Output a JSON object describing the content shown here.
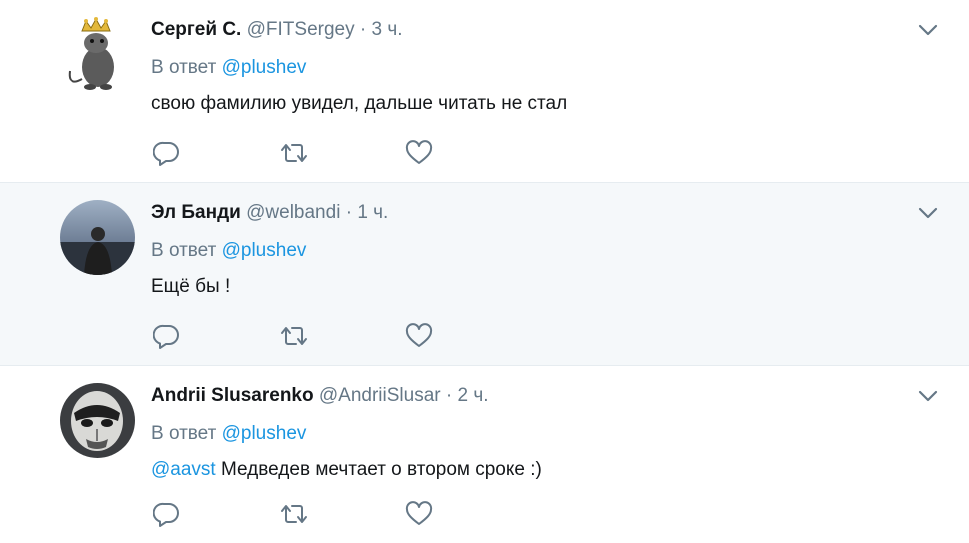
{
  "tweets": [
    {
      "name": "Сергей С.",
      "handle": "@FITSergey",
      "time": "3 ч.",
      "reply_prefix": "В ответ",
      "reply_to": "@plushev",
      "mention": "",
      "text": "свою фамилию увидел, дальше читать не стал"
    },
    {
      "name": "Эл Банди",
      "handle": "@welbandi",
      "time": "1 ч.",
      "reply_prefix": "В ответ",
      "reply_to": "@plushev",
      "mention": "",
      "text": "Ещё бы !"
    },
    {
      "name": "Andrii Slusarenko",
      "handle": "@AndriiSlusar",
      "time": "2 ч.",
      "reply_prefix": "В ответ",
      "reply_to": "@plushev",
      "mention": "@aavst",
      "text": " Медведев мечтает о втором сроке :)"
    }
  ],
  "separator": "·",
  "icons": {
    "reply": "reply-icon",
    "retweet": "retweet-icon",
    "like": "like-icon",
    "caret": "chevron-down-icon"
  },
  "colors": {
    "link": "#1b95e0",
    "secondary_text": "#657786",
    "highlight_row_bg": "#f5f8fa"
  }
}
